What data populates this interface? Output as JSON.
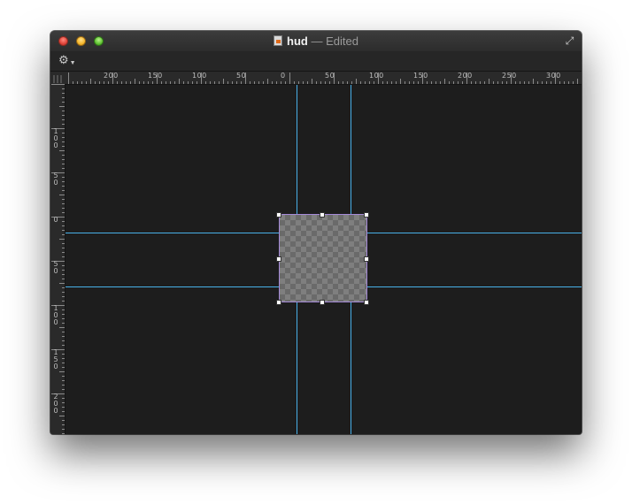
{
  "window": {
    "title": "hud",
    "edited_suffix": "— Edited",
    "document_icon": "document-icon"
  },
  "toolbar": {
    "action_icon": "gear-icon"
  },
  "rulers": {
    "horizontal_labels": [
      "200",
      "150",
      "100",
      "50",
      "0",
      "50",
      "100",
      "150",
      "200",
      "250",
      "300"
    ],
    "vertical_labels": [
      "100",
      "50",
      "0",
      "50",
      "100",
      "150",
      "200"
    ]
  },
  "canvas": {
    "background": "#1d1d1d",
    "guide_color": "#48b0e8",
    "selection_color": "#a58ad8"
  }
}
